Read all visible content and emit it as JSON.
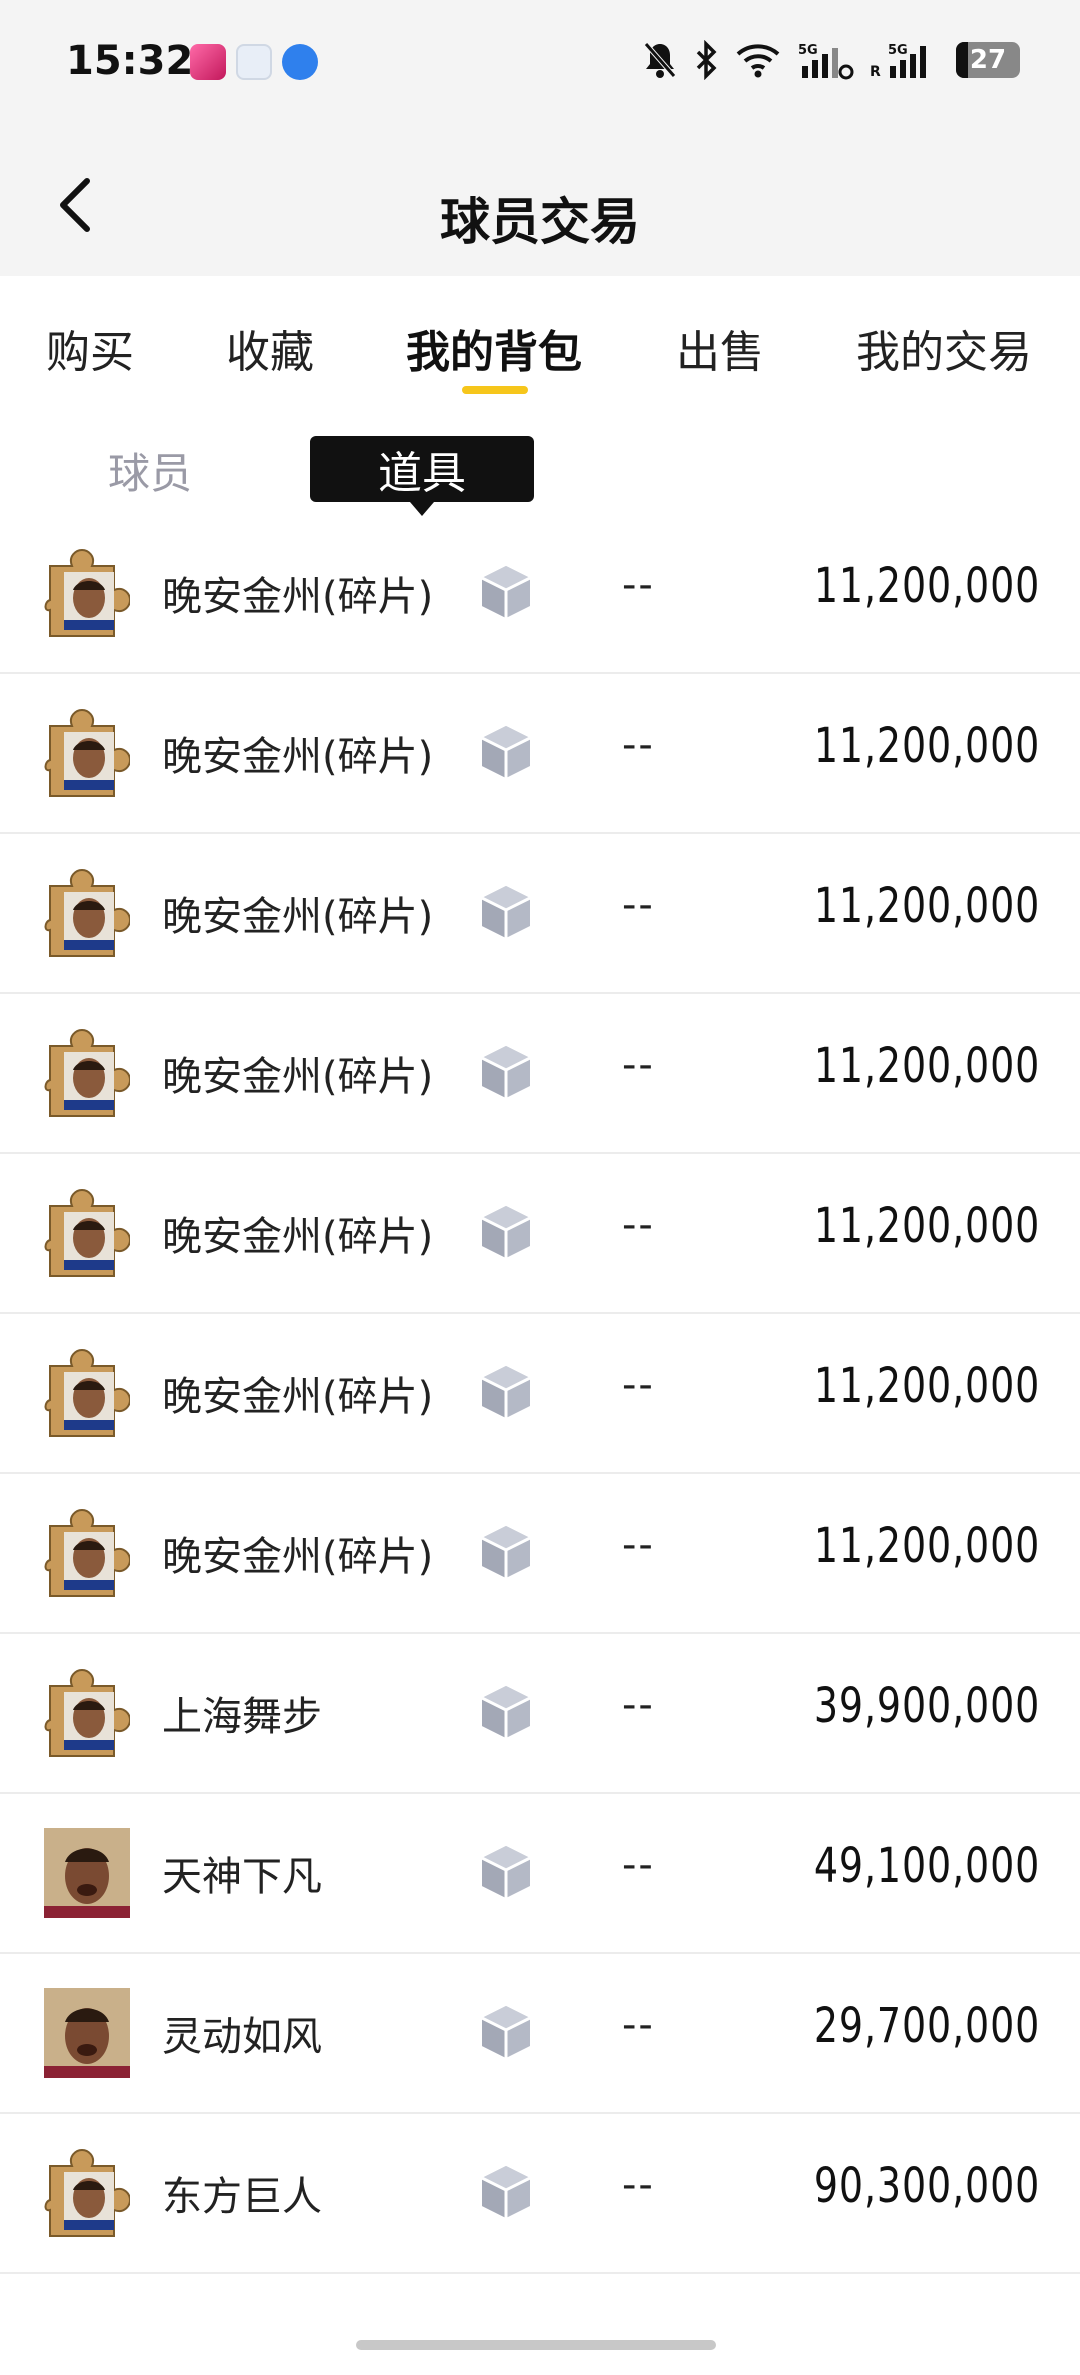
{
  "status_bar": {
    "time": "15:32",
    "battery_level": "27",
    "icons": [
      "app-icon-1",
      "app-icon-2",
      "app-icon-3",
      "mute-bell-icon",
      "bluetooth-icon",
      "wifi-icon",
      "signal-5g-icon",
      "signal-5g-r-icon",
      "battery-icon"
    ]
  },
  "nav": {
    "title": "球员交易"
  },
  "tabs": [
    {
      "label": "购买"
    },
    {
      "label": "收藏"
    },
    {
      "label": "我的背包",
      "active": true
    },
    {
      "label": "出售"
    },
    {
      "label": "我的交易"
    }
  ],
  "subtabs": [
    {
      "label": "球员"
    },
    {
      "label": "道具",
      "active": true
    }
  ],
  "items": [
    {
      "name": "晚安金州(碎片)",
      "value": "--",
      "price": "11,200,000",
      "avatar": "puzzle-player-avatar",
      "icon": "cube-icon"
    },
    {
      "name": "晚安金州(碎片)",
      "value": "--",
      "price": "11,200,000",
      "avatar": "puzzle-player-avatar",
      "icon": "cube-icon"
    },
    {
      "name": "晚安金州(碎片)",
      "value": "--",
      "price": "11,200,000",
      "avatar": "puzzle-player-avatar",
      "icon": "cube-icon"
    },
    {
      "name": "晚安金州(碎片)",
      "value": "--",
      "price": "11,200,000",
      "avatar": "puzzle-player-avatar",
      "icon": "cube-icon"
    },
    {
      "name": "晚安金州(碎片)",
      "value": "--",
      "price": "11,200,000",
      "avatar": "puzzle-player-avatar",
      "icon": "cube-icon"
    },
    {
      "name": "晚安金州(碎片)",
      "value": "--",
      "price": "11,200,000",
      "avatar": "puzzle-player-avatar",
      "icon": "cube-icon"
    },
    {
      "name": "晚安金州(碎片)",
      "value": "--",
      "price": "11,200,000",
      "avatar": "puzzle-player-avatar",
      "icon": "cube-icon"
    },
    {
      "name": "上海舞步",
      "value": "--",
      "price": "39,900,000",
      "avatar": "puzzle-player-avatar",
      "icon": "cube-icon"
    },
    {
      "name": "天神下凡",
      "value": "--",
      "price": "49,100,000",
      "avatar": "player-photo-avatar",
      "icon": "cube-icon"
    },
    {
      "name": "灵动如风",
      "value": "--",
      "price": "29,700,000",
      "avatar": "player-photo-avatar",
      "icon": "cube-icon"
    },
    {
      "name": "东方巨人",
      "value": "--",
      "price": "90,300,000",
      "avatar": "puzzle-player-avatar",
      "icon": "cube-icon"
    }
  ],
  "colors": {
    "accent": "#f6c61b",
    "active_subtab_bg": "#111111",
    "inactive_text": "#9a9aa6",
    "cube": "#b4b9c6"
  }
}
